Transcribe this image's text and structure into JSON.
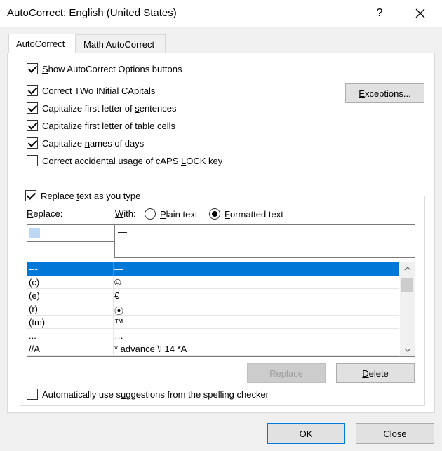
{
  "window": {
    "title": "AutoCorrect: English (United States)",
    "help": "?"
  },
  "tabs": [
    {
      "label": "AutoCorrect",
      "active": true
    },
    {
      "label": "Math AutoCorrect",
      "active": false
    }
  ],
  "options": {
    "show_buttons": {
      "pre": "",
      "u": "S",
      "post": "how AutoCorrect Options buttons",
      "checked": true
    },
    "two_initials": {
      "pre": "C",
      "u": "o",
      "post": "rrect TWo INitial CApitals",
      "checked": true
    },
    "first_letter_sentences": {
      "pre": "Capitalize first letter of ",
      "u": "s",
      "post": "entences",
      "checked": true
    },
    "first_letter_cells": {
      "pre": "Capitalize first letter of table ",
      "u": "c",
      "post": "ells",
      "checked": true
    },
    "names_of_days": {
      "pre": "Capitalize ",
      "u": "n",
      "post": "ames of days",
      "checked": true
    },
    "caps_lock": {
      "pre": "Correct accidental usage of cAPS ",
      "u": "L",
      "post": "OCK key",
      "checked": false
    }
  },
  "exceptions_button": {
    "pre": "",
    "u": "E",
    "post": "xceptions..."
  },
  "replace_section": {
    "checkbox": {
      "pre": "Replace ",
      "u": "t",
      "post": "ext as you type",
      "checked": true
    },
    "replace_label": {
      "pre": "",
      "u": "R",
      "post": "eplace:"
    },
    "with_label": {
      "pre": "",
      "u": "W",
      "post": "ith:"
    },
    "plain_text": {
      "pre": "",
      "u": "P",
      "post": "lain text",
      "checked": false
    },
    "formatted_text": {
      "pre": "",
      "u": "F",
      "post": "ormatted text",
      "checked": true
    },
    "replace_value": "---",
    "with_value": "—"
  },
  "entries": [
    {
      "replace": "---",
      "with": "—",
      "selected": true
    },
    {
      "replace": "(c)",
      "with": "©",
      "selected": false
    },
    {
      "replace": "(e)",
      "with": "€",
      "selected": false
    },
    {
      "replace": "(r)",
      "with": "⦿",
      "selected": false
    },
    {
      "replace": "(tm)",
      "with": "™",
      "selected": false
    },
    {
      "replace": "...",
      "with": "…",
      "selected": false
    },
    {
      "replace": "//A",
      "with": "* advance \\l 14 *A",
      "selected": false
    }
  ],
  "list_buttons": {
    "replace": "Replace",
    "delete": {
      "pre": "",
      "u": "D",
      "post": "elete"
    }
  },
  "spelling_checker": {
    "pre": "Automatically use s",
    "u": "u",
    "post": "ggestions from the spelling checker",
    "checked": false
  },
  "footer": {
    "ok": "OK",
    "close": "Close"
  },
  "colors": {
    "accent": "#0078d7",
    "selected_text_bg": "#bcd8f5"
  }
}
